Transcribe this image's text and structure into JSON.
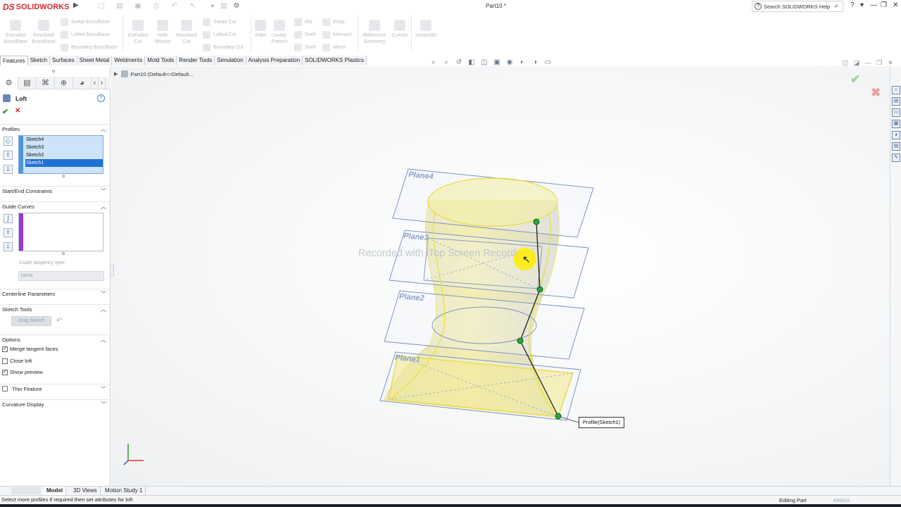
{
  "app": {
    "brand": "SOLIDWORKS",
    "document_title": "Part10 *",
    "help_search_placeholder": "Search SOLIDWORKS Help"
  },
  "ribbon": {
    "features": [
      {
        "label": "Extruded Boss/Base",
        "icon": "extruded-boss-icon"
      },
      {
        "label": "Revolved Boss/Base",
        "icon": "revolved-boss-icon"
      },
      {
        "label": "Swept Boss/Base",
        "icon": "swept-boss-icon"
      },
      {
        "label": "Lofted Boss/Base",
        "icon": "lofted-boss-icon"
      },
      {
        "label": "Boundary Boss/Base",
        "icon": "boundary-boss-icon"
      },
      {
        "label": "Extruded Cut",
        "icon": "extruded-cut-icon"
      },
      {
        "label": "Hole Wizard",
        "icon": "hole-wizard-icon"
      },
      {
        "label": "Revolved Cut",
        "icon": "revolved-cut-icon"
      },
      {
        "label": "Swept Cut",
        "icon": "swept-cut-icon"
      },
      {
        "label": "Lofted Cut",
        "icon": "lofted-cut-icon"
      },
      {
        "label": "Boundary Cut",
        "icon": "boundary-cut-icon"
      },
      {
        "label": "Fillet",
        "icon": "fillet-icon"
      },
      {
        "label": "Linear Pattern",
        "icon": "linear-pattern-icon"
      },
      {
        "label": "Rib",
        "icon": "rib-icon"
      },
      {
        "label": "Draft",
        "icon": "draft-icon"
      },
      {
        "label": "Shell",
        "icon": "shell-icon"
      },
      {
        "label": "Wrap",
        "icon": "wrap-icon"
      },
      {
        "label": "Intersect",
        "icon": "intersect-icon"
      },
      {
        "label": "Mirror",
        "icon": "mirror-icon"
      },
      {
        "label": "Reference Geometry",
        "icon": "reference-geometry-icon"
      },
      {
        "label": "Curves",
        "icon": "curves-icon"
      },
      {
        "label": "Instant3D",
        "icon": "instant3d-icon"
      }
    ]
  },
  "tabs": [
    "Features",
    "Sketch",
    "Surfaces",
    "Sheet Metal",
    "Weldments",
    "Mold Tools",
    "Render Tools",
    "Simulation",
    "Analysis Preparation",
    "SOLIDWORKS Plastics"
  ],
  "active_tab": "Features",
  "tree_path": "Part10  (Default<<Default...",
  "property_manager": {
    "title": "Loft",
    "profiles": {
      "header": "Profiles",
      "items": [
        "Sketch4",
        "Sketch3",
        "Sketch2",
        "Sketch1"
      ],
      "selected": "Sketch1"
    },
    "start_end_constraints": "Start/End Constraints",
    "guide_curves": {
      "header": "Guide Curves",
      "tangency_label": "Guide tangency type:",
      "tangency_value": "None"
    },
    "centerline_parameters": "Centerline Parameters",
    "sketch_tools": {
      "header": "Sketch Tools",
      "drag_sketch": "Drag Sketch"
    },
    "options": {
      "header": "Options",
      "merge_tangent_faces": {
        "label": "Merge tangent faces",
        "checked": true
      },
      "close_loft": {
        "label": "Close loft",
        "checked": false
      },
      "show_preview": {
        "label": "Show preview",
        "checked": true
      }
    },
    "thin_feature": "Thin Feature",
    "curvature_display": "Curvature Display"
  },
  "viewport": {
    "planes": [
      "Plane4",
      "Plane3",
      "Plane2",
      "Plane1"
    ],
    "callout": "Profile(Sketch1)",
    "watermark": "Recorded with iTop Screen Recorder"
  },
  "bottom_tabs": [
    "Model",
    "3D Views",
    "Motion Study 1"
  ],
  "status": {
    "message": "Select more profiles if required then set attributes for loft",
    "mode": "Editing Part",
    "units": "MMGS"
  },
  "colors": {
    "brand_red": "#d9262e",
    "selection_blue": "#1d72d6",
    "guide_purple": "#9b33e0",
    "preview_yellow": "#f2ea9a",
    "ok_green": "#2e9a2e",
    "cancel_red": "#c3282e"
  }
}
